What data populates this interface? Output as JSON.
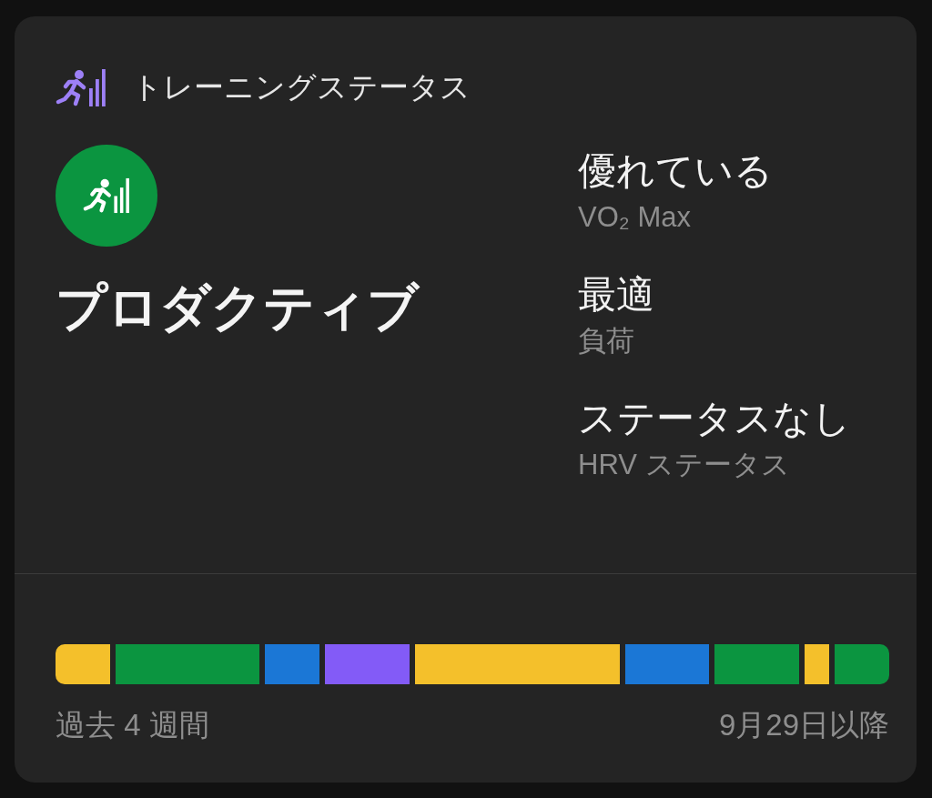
{
  "header": {
    "title": "トレーニングステータス"
  },
  "status": {
    "label": "プロダクティブ"
  },
  "metrics": [
    {
      "value": "優れている",
      "label": "VO₂ Max"
    },
    {
      "value": "最適",
      "label": "負荷"
    },
    {
      "value": "ステータスなし",
      "label": "HRV ステータス"
    }
  ],
  "timeline": {
    "segments": [
      {
        "color": "#f4c02b"
      },
      {
        "color": "#0b9540"
      },
      {
        "color": "#1b77d6"
      },
      {
        "color": "#835bf7"
      },
      {
        "color": "#f4c02b"
      },
      {
        "color": "#1b77d6"
      },
      {
        "color": "#0b9540"
      },
      {
        "color": "#f4c02b"
      },
      {
        "color": "#0b9540"
      }
    ],
    "start_label": "過去 4 週間",
    "end_label": "9月29日以降"
  }
}
